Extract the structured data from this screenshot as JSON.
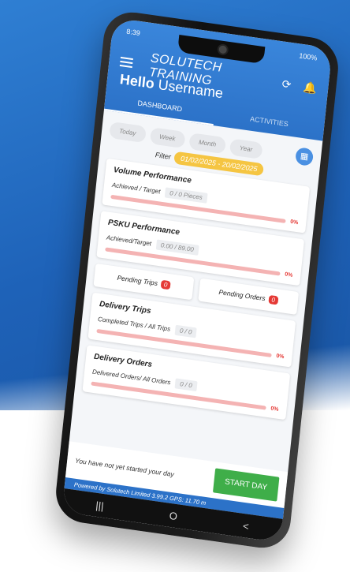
{
  "app": {
    "title": "SOLUTECH TRAINING",
    "greeting_bold": "Hello",
    "greeting_user": "Username",
    "status_time": "8:39",
    "battery": "100%"
  },
  "tabs": [
    {
      "label": "DASHBOARD",
      "active": true
    },
    {
      "label": "ACTIVITIES",
      "active": false
    }
  ],
  "periods": [
    "Today",
    "Week",
    "Month",
    "Year"
  ],
  "filter": {
    "label": "Filter",
    "range": "01/02/2025 - 20/02/2025"
  },
  "volume": {
    "title": "Volume Performance",
    "metric_label": "Achieved / Target",
    "metric_value": "0 / 0 Pieces",
    "percent": "0%"
  },
  "psku": {
    "title": "PSKU Performance",
    "metric_label": "Achieved/Target",
    "metric_value": "0.00 / 89.00",
    "percent": "0%"
  },
  "pending": {
    "trips_label": "Pending Trips",
    "trips_count": "0",
    "orders_label": "Pending Orders",
    "orders_count": "0"
  },
  "delivery_trips": {
    "title": "Delivery Trips",
    "metric_label": "Completed Trips / All Trips",
    "metric_value": "0 / 0",
    "percent": "0%"
  },
  "delivery_orders": {
    "title": "Delivery Orders",
    "metric_label": "Delivered Orders/ All Orders",
    "metric_value": "0 / 0",
    "percent": "0%"
  },
  "footer": {
    "message": "You have not yet started your day",
    "start_button": "START DAY",
    "powered_by": "Powered by Solutech Limited 3.99.2 GPS: 11.70 m"
  },
  "nav": {
    "recents": "|||",
    "home": "O",
    "back": "<"
  },
  "colors": {
    "primary": "#2c72c8",
    "accent_green": "#3fae49",
    "badge_red": "#e53935",
    "filter_yellow": "#f5c542"
  }
}
